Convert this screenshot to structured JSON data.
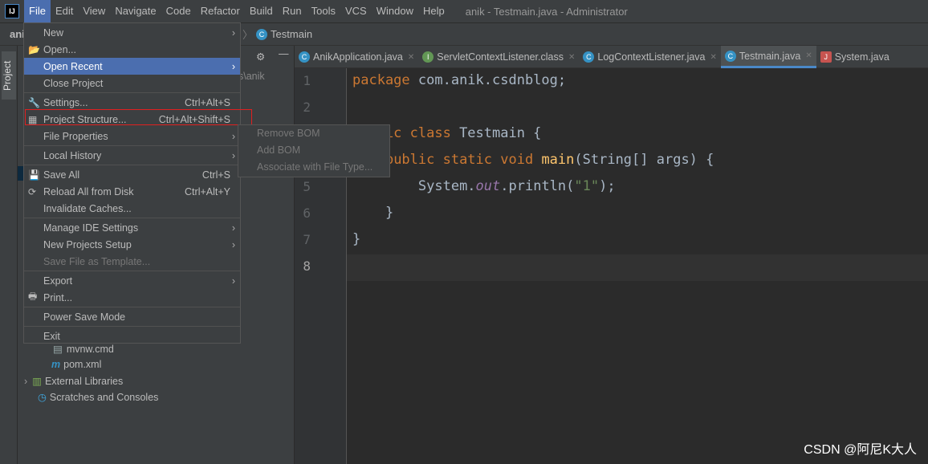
{
  "menubar": {
    "items": [
      "File",
      "Edit",
      "View",
      "Navigate",
      "Code",
      "Refactor",
      "Build",
      "Run",
      "Tools",
      "VCS",
      "Window",
      "Help"
    ],
    "window_title": "anik - Testmain.java - Administrator"
  },
  "breadcrumb": {
    "project": "ani",
    "partial": "g",
    "file": "Testmain"
  },
  "sidebar": {
    "project_tab": "Project",
    "path_fragment": "s\\anik"
  },
  "tabs": [
    {
      "label": "AnikApplication.java",
      "color": "#3592c4"
    },
    {
      "label": "ServletContextListener.class",
      "color": "#629755"
    },
    {
      "label": "LogContextListener.java",
      "color": "#3592c4"
    },
    {
      "label": "Testmain.java",
      "color": "#3592c4",
      "active": true
    },
    {
      "label": "System.java",
      "color": "#c75450"
    }
  ],
  "code": {
    "lines": [
      "1",
      "2",
      "3",
      "4",
      "5",
      "6",
      "7",
      "8"
    ],
    "l1": {
      "kw": "package",
      "rest": " com.anik.csdnblog;"
    },
    "l3": {
      "kw": "public class",
      "name": " Testmain {"
    },
    "l4": {
      "kw": "public static void",
      "fn": "main",
      "rest": "(String[] args) {"
    },
    "l5": {
      "a": "System.",
      "fld": "out",
      "b": ".println(",
      "str": "\"1\"",
      "c": ");"
    },
    "l6": "}",
    "l7": "}"
  },
  "file_menu": {
    "items": [
      {
        "label": "New",
        "arrow": true
      },
      {
        "label": "Open...",
        "icon": "folder-icon"
      },
      {
        "label": "Open Recent",
        "arrow": true,
        "highlighted": true
      },
      {
        "label": "Close Project"
      },
      {
        "label": "Settings...",
        "shortcut": "Ctrl+Alt+S",
        "icon": "wrench-icon"
      },
      {
        "label": "Project Structure...",
        "shortcut": "Ctrl+Alt+Shift+S",
        "icon": "project-structure-icon"
      },
      {
        "label": "File Properties",
        "arrow": true
      },
      {
        "label": "Local History",
        "arrow": true
      },
      {
        "label": "Save All",
        "shortcut": "Ctrl+S",
        "icon": "save-icon"
      },
      {
        "label": "Reload All from Disk",
        "shortcut": "Ctrl+Alt+Y",
        "icon": "reload-icon"
      },
      {
        "label": "Invalidate Caches..."
      },
      {
        "label": "Manage IDE Settings",
        "arrow": true
      },
      {
        "label": "New Projects Setup",
        "arrow": true
      },
      {
        "label": "Save File as Template...",
        "disabled": true
      },
      {
        "label": "Export",
        "arrow": true
      },
      {
        "label": "Print...",
        "icon": "print-icon"
      },
      {
        "label": "Power Save Mode"
      },
      {
        "label": "Exit"
      }
    ]
  },
  "submenu": {
    "items": [
      "Remove BOM",
      "Add BOM",
      "Associate with File Type..."
    ]
  },
  "tree": {
    "items": [
      "mvnw.cmd",
      "pom.xml",
      "External Libraries",
      "Scratches and Consoles"
    ]
  },
  "watermark": "CSDN @阿尼K大人"
}
